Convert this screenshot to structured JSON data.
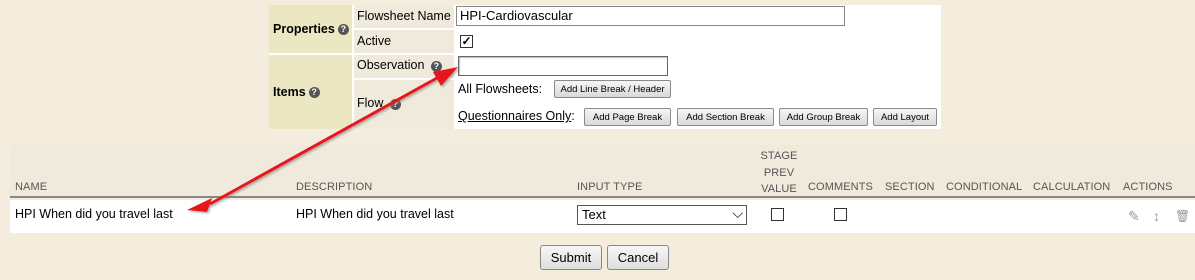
{
  "properties": {
    "header": "Properties",
    "flowsheet_name_label": "Flowsheet Name",
    "flowsheet_name_value": "HPI-Cardiovascular",
    "active_label": "Active",
    "active_checked": true,
    "active_mark": "✓"
  },
  "items": {
    "header": "Items",
    "observation_label": "Observation",
    "observation_value": "",
    "flow_label": "Flow",
    "all_flowsheets_label": "All Flowsheets:",
    "add_line_break_label": "Add Line Break / Header",
    "questionnaires_only_label": "Questionnaires Only",
    "questionnaires_colon": ":",
    "add_page_break_label": "Add Page Break",
    "add_section_break_label": "Add Section Break",
    "add_group_break_label": "Add Group Break",
    "add_layout_label": "Add Layout"
  },
  "grid": {
    "columns": {
      "name": "NAME",
      "description": "DESCRIPTION",
      "input_type": "INPUT TYPE",
      "stage_prev_value": [
        "STAGE",
        "PREV",
        "VALUE"
      ],
      "comments": "COMMENTS",
      "section": "SECTION",
      "conditional": "CONDITIONAL",
      "calculation": "CALCULATION",
      "actions": "ACTIONS"
    },
    "rows": [
      {
        "name": "HPI When did you travel last",
        "description": "HPI When did you travel last",
        "input_type": "Text",
        "stage_prev_value": false,
        "comments": false
      }
    ]
  },
  "icons": {
    "help": "?",
    "chevron": "⌵",
    "edit": "✎",
    "move": "↕",
    "delete": "🗑"
  },
  "footer": {
    "submit_label": "Submit",
    "cancel_label": "Cancel"
  },
  "annotation": {
    "arrow_color": "#e8191f"
  }
}
